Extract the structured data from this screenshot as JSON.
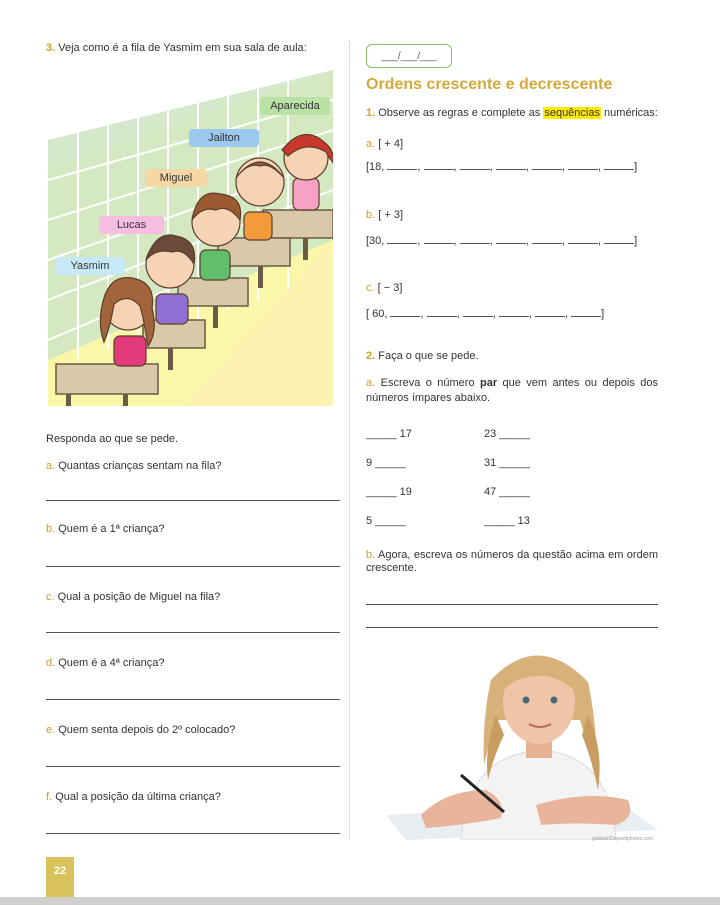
{
  "left": {
    "q3_num": "3.",
    "q3_text": "Veja como é a fila de Yasmim em sua sala de aula:",
    "names": [
      "Aparecida",
      "Jailton",
      "Miguel",
      "Lucas",
      "Yasmim"
    ],
    "instruction": "Responda ao que se pede.",
    "questions": [
      {
        "letter": "a.",
        "text": "Quantas crianças sentam na fila?"
      },
      {
        "letter": "b.",
        "text": "Quem é a 1ª criança?"
      },
      {
        "letter": "c.",
        "text": "Qual a posição de Miguel na fila?"
      },
      {
        "letter": "d.",
        "text": "Quem é a 4ª criança?"
      },
      {
        "letter": "e.",
        "text": "Quem senta depois do 2º colocado?"
      },
      {
        "letter": "f.",
        "text": "Qual a posição da última criança?"
      }
    ]
  },
  "right": {
    "date": "___/___/___",
    "title": "Ordens crescente e decrescente",
    "q1_num": "1.",
    "q1_pre": "Observe as regras e complete as ",
    "q1_hl": "sequências",
    "q1_post": " numéricas:",
    "seqs": [
      {
        "letter": "a.",
        "rule": "[ + 4]",
        "start": "[18, ",
        "blanks": 7
      },
      {
        "letter": "b.",
        "rule": "[ + 3]",
        "start": "[30, ",
        "blanks": 7
      },
      {
        "letter": "c.",
        "rule": "[ − 3]",
        "start": "[ 60, ",
        "blanks": 6
      }
    ],
    "q2_num": "2.",
    "q2_text": "Faça o que se pede.",
    "q2a_letter": "a.",
    "q2a_pre": "Escreva o número ",
    "q2a_bold": "par",
    "q2a_post": " que vem antes ou depois dos números ímpares abaixo.",
    "pairs": [
      {
        "left": "_____ 17",
        "right": "23 _____"
      },
      {
        "left": "9 _____",
        "right": "31 _____"
      },
      {
        "left": "_____ 19",
        "right": "47 _____"
      },
      {
        "left": "5 _____",
        "right": "_____ 13"
      }
    ],
    "q2b_letter": "b.",
    "q2b_text": "Agora, escreva os números da questão acima em ordem crescente.",
    "photo_credit": "goldeer/Depositphotos.com"
  },
  "page_number": "22"
}
